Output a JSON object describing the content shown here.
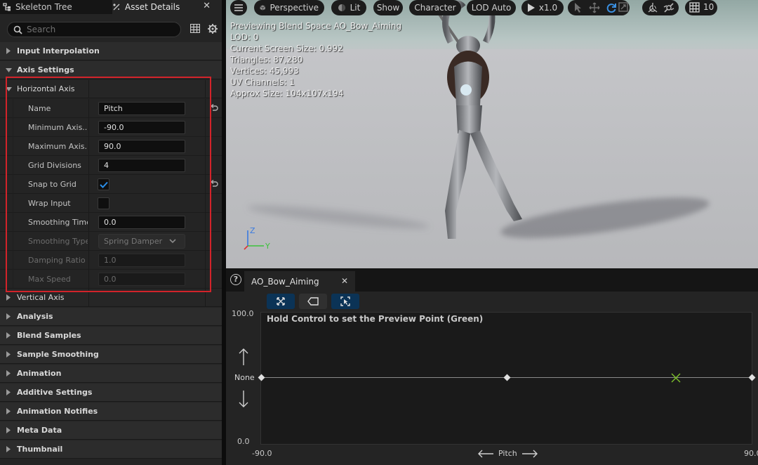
{
  "tabs": {
    "skeleton_tree": "Skeleton Tree",
    "asset_details": "Asset Details",
    "close": "✕"
  },
  "search": {
    "placeholder": "Search"
  },
  "categories": {
    "input_interpolation": "Input Interpolation",
    "axis_settings": "Axis Settings",
    "horizontal_axis": "Horizontal Axis",
    "vertical_axis": "Vertical Axis",
    "analysis": "Analysis",
    "blend_samples": "Blend Samples",
    "sample_smoothing": "Sample Smoothing",
    "animation": "Animation",
    "additive_settings": "Additive Settings",
    "animation_notifies": "Animation Notifies",
    "meta_data": "Meta Data",
    "thumbnail": "Thumbnail"
  },
  "horizontal_axis": {
    "name_label": "Name",
    "name_value": "Pitch",
    "min_label": "Minimum Axis...",
    "min_value": "-90.0",
    "max_label": "Maximum Axis...",
    "max_value": "90.0",
    "grid_label": "Grid Divisions",
    "grid_value": "4",
    "snap_label": "Snap to Grid",
    "snap_checked": true,
    "wrap_label": "Wrap Input",
    "wrap_checked": false,
    "smooth_time_label": "Smoothing Time",
    "smooth_time_value": "0.0",
    "smooth_type_label": "Smoothing Type",
    "smooth_type_value": "Spring Damper",
    "damping_label": "Damping Ratio",
    "damping_value": "1.0",
    "max_speed_label": "Max Speed",
    "max_speed_value": "0.0"
  },
  "viewport": {
    "toolbar": {
      "perspective": "Perspective",
      "lit": "Lit",
      "show": "Show",
      "character": "Character",
      "lod": "LOD Auto",
      "speed": "x1.0",
      "grid_size": "10"
    },
    "stats": [
      "Previewing Blend Space AO_Bow_Aiming",
      "LOD: 0",
      "Current Screen Size: 0.992",
      "Triangles: 87,280",
      "Vertices: 45,993",
      "UV Channels: 1",
      "Approx Size: 104x107x194"
    ],
    "axis_z": "Z",
    "axis_y": "Y"
  },
  "blendspace": {
    "help": "?",
    "tab_title": "AO_Bow_Aiming",
    "tab_close": "✕",
    "hint": "Hold Control to set the Preview Point (Green)",
    "y_max": "100.0",
    "y_min": "0.0",
    "y_axis": "None",
    "x_min": "-90.0",
    "x_max": "90.0",
    "x_axis": "Pitch",
    "sample_points": [
      -90,
      0,
      90
    ],
    "preview_point": 62,
    "colors": {
      "preview": "#7ec12b",
      "selected_button": "#0b3356"
    }
  }
}
